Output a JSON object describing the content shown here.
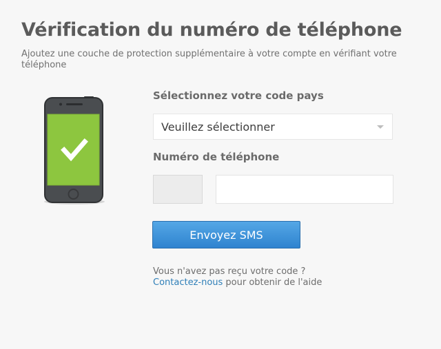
{
  "page": {
    "title": "Vérification du numéro de téléphone",
    "subtitle": "Ajoutez une couche de protection supplémentaire à votre compte en vérifiant votre téléphone"
  },
  "country": {
    "label": "Sélectionnez votre code pays",
    "selected": "Veuillez sélectionner"
  },
  "phone": {
    "label": "Numéro de téléphone",
    "prefix_value": "",
    "number_value": "",
    "number_placeholder": ""
  },
  "actions": {
    "send_sms_label": "Envoyez SMS"
  },
  "help": {
    "question": "Vous n'avez pas reçu votre code ?",
    "contact_link": "Contactez-nous",
    "contact_suffix": " pour obtenir de l'aide"
  },
  "icons": {
    "phone": "smartphone-check-icon",
    "caret": "chevron-down-icon"
  },
  "colors": {
    "button": "#3a8fd8",
    "screen": "#8dc63f",
    "link": "#2f7fb8"
  }
}
